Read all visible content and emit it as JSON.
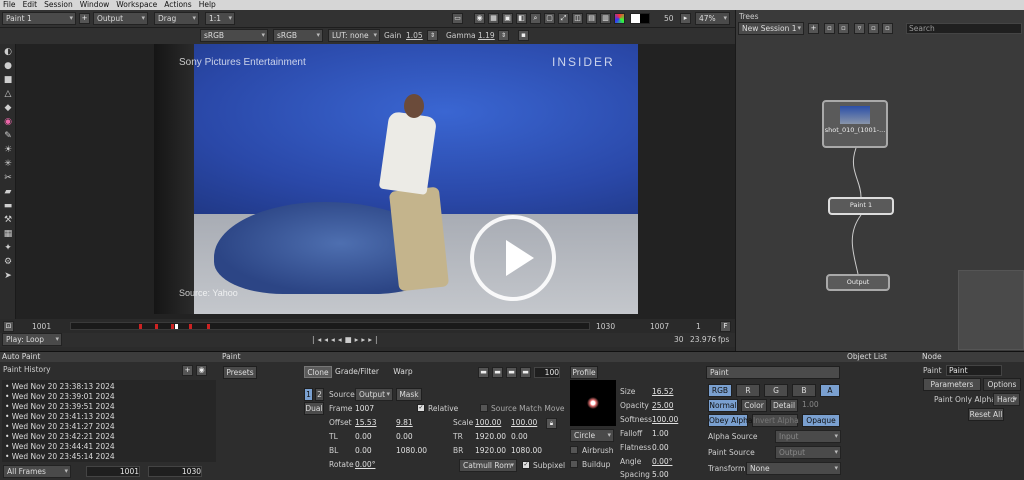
{
  "menu": [
    "File",
    "Edit",
    "Session",
    "Window",
    "Workspace",
    "Actions",
    "Help"
  ],
  "toolbar": {
    "node_select": "Paint 1",
    "output_select": "Output",
    "drag_select": "Drag",
    "ratio_select": "1:1",
    "zoom_value": "50",
    "zoom_pct": "47%"
  },
  "toolbar2": {
    "cs1": "sRGB",
    "cs2": "sRGB",
    "lut": "LUT: none",
    "gain_label": "Gain",
    "gain_value": "1.05",
    "gamma_label": "Gamma",
    "gamma_value": "1.19"
  },
  "video": {
    "watermark_top": "Sony Pictures Entertainment",
    "brand": "INSIDER",
    "source": "Source: Yahoo"
  },
  "timeline": {
    "start": "1001",
    "current": "1030",
    "end": "1007",
    "step": "1",
    "mode": "Play: Loop",
    "frame": "30",
    "fps": "23.976",
    "fps_unit": "fps"
  },
  "trees": {
    "title": "Trees",
    "session": "New Session 1",
    "search_placeholder": "Search",
    "nodes": [
      "shot_010_(1001-...",
      "Paint 1",
      "Output"
    ]
  },
  "autopaint": {
    "title": "Auto Paint",
    "history_title": "Paint History",
    "items": [
      "Wed Nov 20 23:38:13 2024",
      "Wed Nov 20 23:39:01 2024",
      "Wed Nov 20 23:39:51 2024",
      "Wed Nov 20 23:41:13 2024",
      "Wed Nov 20 23:41:27 2024",
      "Wed Nov 20 23:42:21 2024",
      "Wed Nov 20 23:44:41 2024",
      "Wed Nov 20 23:45:14 2024"
    ],
    "frames_select": "All Frames",
    "from": "1001",
    "to": "1030"
  },
  "paint": {
    "title": "Paint",
    "presets": "Presets",
    "tabs": [
      "Clone",
      "Grade/Filter",
      "Warp"
    ],
    "brush_size": "100",
    "profile": "Profile",
    "n1": "1",
    "n2": "2",
    "dual": "Dual",
    "source_label": "Source",
    "source_value": "Output",
    "mask": "Mask",
    "frame_label": "Frame",
    "frame_value": "1007",
    "relative": "Relative",
    "source_match": "Source Match Move",
    "offset_label": "Offset",
    "offset_x": "15.53",
    "offset_y": "9.81",
    "scale_label": "Scale",
    "scale_x": "100.00",
    "scale_y": "100.00",
    "tl_label": "TL",
    "tl_x": "0.00",
    "tl_y": "0.00",
    "tr_label": "TR",
    "tr_x": "1920.00",
    "tr_y": "0.00",
    "bl_label": "BL",
    "bl_x": "0.00",
    "bl_y": "1080.00",
    "br_label": "BR",
    "br_x": "1920.00",
    "br_y": "1080.00",
    "rotate_label": "Rotate",
    "rotate_value": "0.00°",
    "filter": "Catmull Rom",
    "subpixel": "Subpixel",
    "shape": "Circle",
    "airbrush": "Airbrush",
    "buildup": "Buildup",
    "props": [
      {
        "label": "Size",
        "value": "16.52"
      },
      {
        "label": "Opacity",
        "value": "25.00"
      },
      {
        "label": "Softness",
        "value": "100.00"
      },
      {
        "label": "Falloff",
        "value": "1.00"
      },
      {
        "label": "Flatness",
        "value": "0.00"
      },
      {
        "label": "Angle",
        "value": "0.00°"
      },
      {
        "label": "Spacing",
        "value": "5.00"
      }
    ],
    "paint_hdr": "Paint",
    "channels": [
      "RGB",
      "R",
      "G",
      "B",
      "A"
    ],
    "modes": [
      "Normal",
      "Color",
      "Detail"
    ],
    "mode_value": "1.00",
    "obey_alpha": "Obey Alpha",
    "invert_alpha": "Invert Alpha",
    "opaque": "Opaque",
    "alpha_source_label": "Alpha Source",
    "alpha_source_value": "Input",
    "paint_source_label": "Paint Source",
    "paint_source_value": "Output",
    "transform_label": "Transform",
    "transform_value": "None"
  },
  "objectlist": {
    "title": "Object List"
  },
  "nodepanel": {
    "title": "Node",
    "tab1": "Paint",
    "tab2": "Paint",
    "params": "Parameters",
    "options": "Options",
    "alpha_label": "Paint Only Alpha",
    "alpha_value": "Hard",
    "reset": "Reset All"
  },
  "colors": {
    "accent": "#7aa0d0",
    "bg": "#2b2b2b",
    "menu": "#d6d6d6"
  }
}
